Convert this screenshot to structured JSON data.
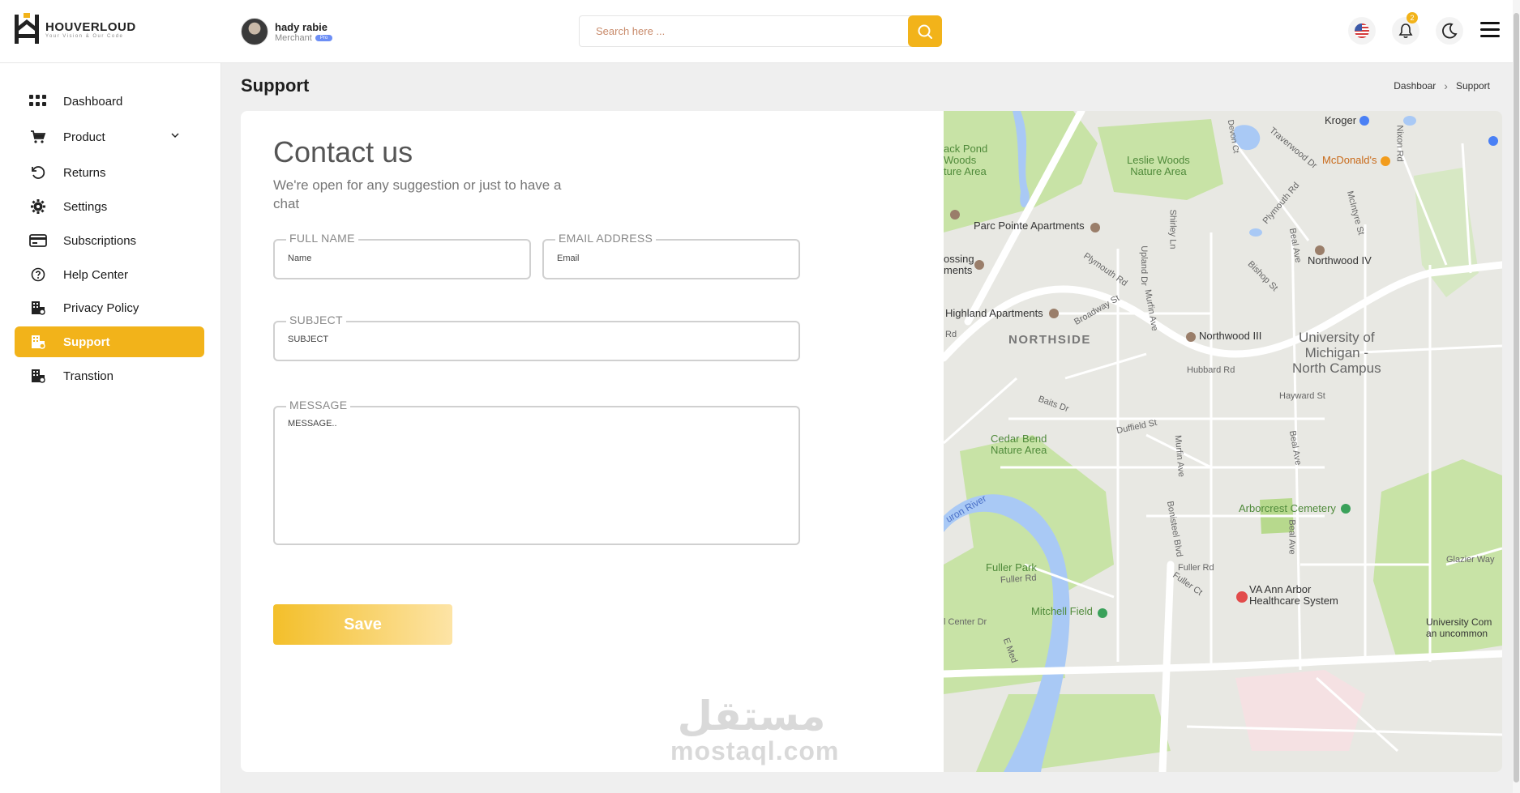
{
  "brand": {
    "name": "HOUVERLOUD",
    "tagline": "Your Vision & Our Code"
  },
  "user": {
    "name": "hady rabie",
    "role": "Merchant",
    "badge": "Pro"
  },
  "search": {
    "placeholder": "Search here ..."
  },
  "header": {
    "notification_count": "2"
  },
  "sidebar": {
    "items": [
      {
        "label": "Dashboard",
        "icon": "grid-icon"
      },
      {
        "label": "Product",
        "icon": "cart-icon"
      },
      {
        "label": "Returns",
        "icon": "undo-icon"
      },
      {
        "label": "Settings",
        "icon": "gear-icon"
      },
      {
        "label": "Subscriptions",
        "icon": "credit-card-icon"
      },
      {
        "label": "Help Center",
        "icon": "help-icon"
      },
      {
        "label": "Privacy Policy",
        "icon": "building-icon"
      },
      {
        "label": "Support",
        "icon": "building-icon",
        "active": true
      },
      {
        "label": "Transtion",
        "icon": "building-icon"
      }
    ]
  },
  "page": {
    "title": "Support",
    "breadcrumb": [
      "Dashboar",
      "Support"
    ]
  },
  "contact": {
    "title": "Contact us",
    "subtitle": "We're open for any suggestion or just to have a chat",
    "fields": {
      "full_name": {
        "label": "FULL NAME",
        "placeholder": "Name"
      },
      "email": {
        "label": "EMAIL ADDRESS",
        "placeholder": "Email"
      },
      "subject": {
        "label": "SUBJECT",
        "placeholder": "SUBJECT"
      },
      "message": {
        "label": "MESSAGE",
        "placeholder": "MESSAGE.."
      }
    },
    "save_label": "Save"
  },
  "watermark": {
    "arabic": "مستقل",
    "latin": "mostaql.com"
  },
  "map": {
    "labels": {
      "pond": "ack Pond\nWoods\nture Area",
      "leslie": "Leslie Woods\nNature Area",
      "kroger": "Kroger",
      "mcdonalds": "McDonald's",
      "parc": "Parc Pointe Apartments",
      "crossing": "ossing\nments",
      "northwood4": "Northwood IV",
      "highland": "Highland Apartments",
      "northside": "NORTHSIDE",
      "northwood3": "Northwood III",
      "umich": "University of\nMichigan -\nNorth Campus",
      "hubbard": "Hubbard Rd",
      "hayward": "Hayward St",
      "baits": "Baits Dr",
      "duffield": "Duffield St",
      "cedar": "Cedar Bend\nNature Area",
      "huron": "uron River",
      "arborcrest": "Arborcrest Cemetery",
      "fullerpark": "Fuller Park",
      "fullerrd": "Fuller Rd",
      "fullerrd2": "Fuller Rd",
      "fullerct": "Fuller Ct",
      "glazier": "Glazier Way",
      "va": "VA Ann Arbor\nHealthcare System",
      "mitchell": "Mitchell Field",
      "center": "l Center Dr",
      "univcom": "University Com\nan uncommon",
      "plymouth": "Plymouth Rd",
      "plymouth2": "Plymouth Rd",
      "broadway": "Broadway St",
      "murfin": "Murfin Ave",
      "murfin2": "Murfin Ave",
      "bishop": "Bishop St",
      "beal": "Beal Ave",
      "beal2": "Beal Ave",
      "beal3": "Beal Ave",
      "upland": "Upland Dr",
      "shirley": "Shirley Ln",
      "traverwood": "Traverwood Dr",
      "mcintyre": "McIntyre St",
      "nixon": "Nixon Rd",
      "devon": "Devon Ct",
      "bonisteel": "Bonisteel Blvd",
      "rd": "Rd",
      "emed": "E Med"
    }
  },
  "colors": {
    "accent": "#f2b31a",
    "map_park": "#c8e3a6",
    "map_water": "#a9c9f5"
  }
}
